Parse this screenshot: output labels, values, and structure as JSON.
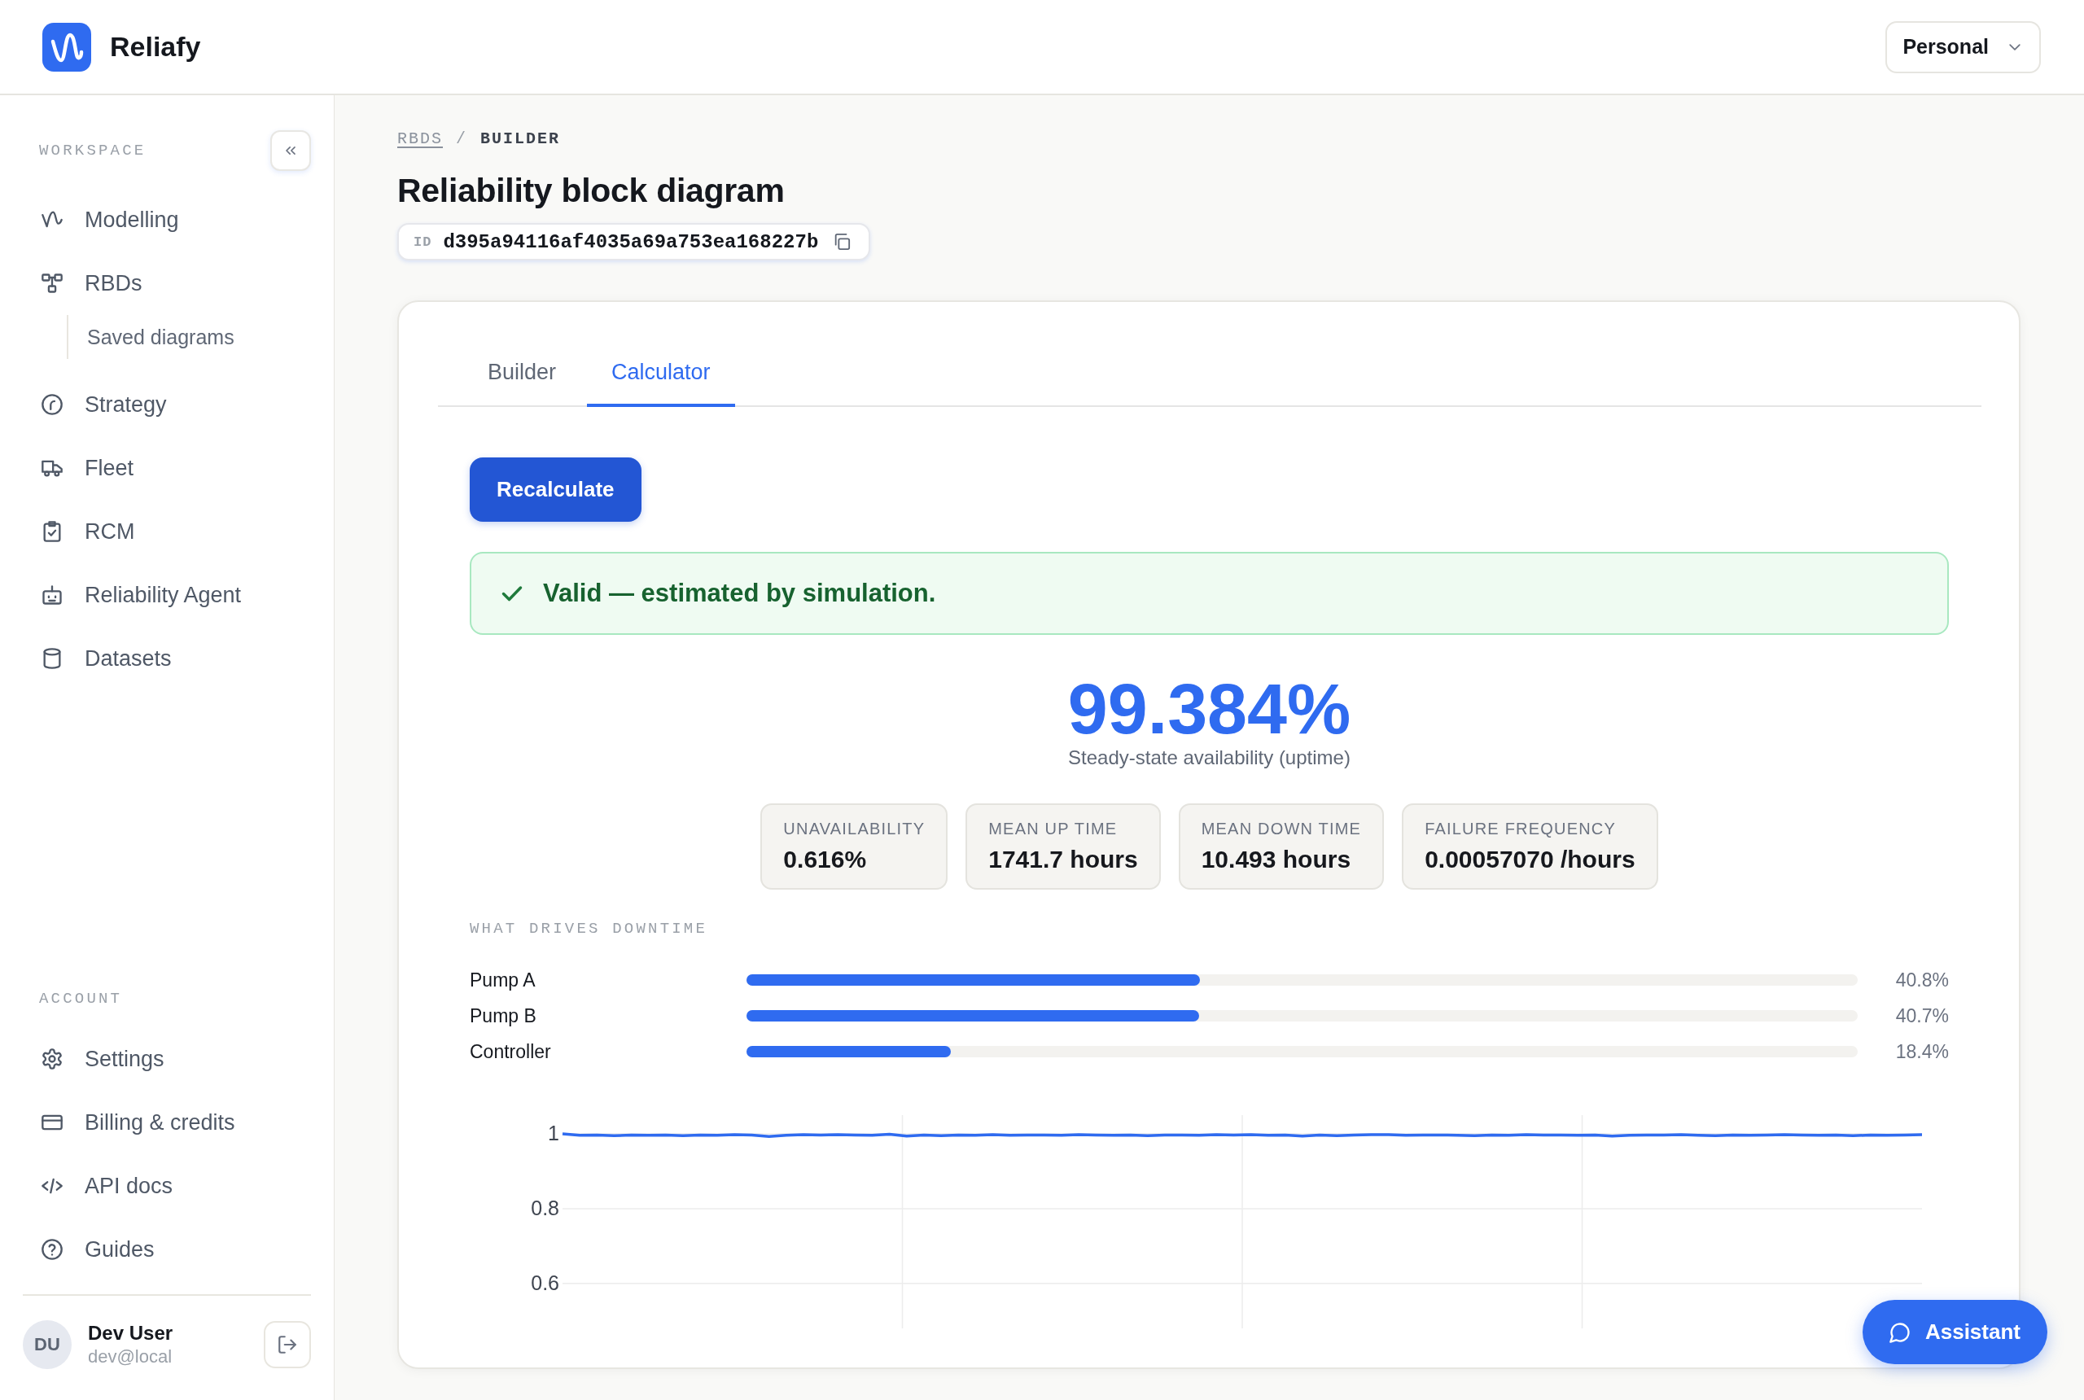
{
  "header": {
    "app_name": "Reliafy",
    "workspace_menu": {
      "label": "Personal"
    }
  },
  "sidebar": {
    "sections": [
      {
        "title": "WORKSPACE",
        "items": [
          {
            "label": "Modelling",
            "selected": false
          },
          {
            "label": "RBDs",
            "selected": false,
            "children": [
              {
                "label": "Saved diagrams",
                "selected": false
              }
            ]
          },
          {
            "label": "Strategy",
            "selected": false
          },
          {
            "label": "Fleet",
            "selected": false
          },
          {
            "label": "RCM",
            "selected": false
          },
          {
            "label": "Reliability Agent",
            "selected": false
          },
          {
            "label": "Datasets",
            "selected": false
          }
        ]
      },
      {
        "title": "ACCOUNT",
        "items": [
          {
            "label": "Settings",
            "selected": false
          },
          {
            "label": "Billing & credits",
            "selected": false
          },
          {
            "label": "API docs",
            "selected": false
          },
          {
            "label": "Guides",
            "selected": false
          }
        ]
      }
    ],
    "user": {
      "initials": "DU",
      "name": "Dev User",
      "email": "dev@local"
    }
  },
  "breadcrumb": {
    "separator": "/",
    "items": [
      {
        "kind": "link",
        "label": "RBDS"
      },
      {
        "kind": "current",
        "label": "BUILDER"
      }
    ]
  },
  "page_title": "Reliability block diagram",
  "id_chip": {
    "label": "ID",
    "value": "d395a94116af4035a69a753ea168227b"
  },
  "tabs": [
    {
      "label": "Builder",
      "selected": false
    },
    {
      "label": "Calculator",
      "selected": true
    }
  ],
  "calculator": {
    "recalculate_button": "Recalculate",
    "status": {
      "kind": "success",
      "text": "Valid — estimated by simulation."
    },
    "headline": {
      "value": "99.384%",
      "caption": "Steady-state availability (uptime)"
    },
    "metrics": [
      {
        "label": "UNAVAILABILITY",
        "value": "0.616%"
      },
      {
        "label": "MEAN UP TIME",
        "value": "1741.7 hours"
      },
      {
        "label": "MEAN DOWN TIME",
        "value": "10.493 hours"
      },
      {
        "label": "FAILURE FREQUENCY",
        "value": "0.00057070 /hours"
      }
    ],
    "downtime_drivers": {
      "title": "WHAT DRIVES DOWNTIME",
      "items": [
        {
          "name": "Pump A",
          "level": 0.408,
          "reading": "40.8%"
        },
        {
          "name": "Pump B",
          "level": 0.407,
          "reading": "40.7%"
        },
        {
          "name": "Controller",
          "level": 0.184,
          "reading": "18.4%"
        }
      ]
    },
    "chart": {
      "chart_data": {
        "type": "line",
        "grid": true,
        "ylim": [
          0.48,
          1.05
        ],
        "yticks": [
          0.6,
          0.8,
          1
        ],
        "series": [
          {
            "color": "#2f6bf0",
            "values": [
              1.0,
              0.996,
              0.997,
              0.995,
              0.997,
              0.996,
              0.997,
              0.995,
              0.997,
              0.996,
              0.998,
              0.997,
              0.993,
              0.996,
              0.998,
              0.997,
              0.998,
              0.997,
              0.996,
              0.999,
              0.994,
              0.997,
              0.995,
              0.997,
              0.996,
              0.998,
              0.996,
              0.997,
              0.997,
              0.996,
              0.998,
              0.997,
              0.996,
              0.997,
              0.995,
              0.997,
              0.997,
              0.996,
              0.998,
              0.997,
              0.998,
              0.996,
              0.997,
              0.994,
              0.997,
              0.995,
              0.997,
              0.998,
              0.998,
              0.996,
              0.997,
              0.997,
              0.996,
              0.995,
              0.997,
              0.996,
              0.998,
              0.997,
              0.997,
              0.996,
              0.997,
              0.994,
              0.996,
              0.997,
              0.997,
              0.998,
              0.996,
              0.995,
              0.997,
              0.996,
              0.997,
              0.998,
              0.997,
              0.996,
              0.997,
              0.995,
              0.997,
              0.996,
              0.997,
              0.998
            ]
          }
        ]
      }
    }
  },
  "assistant_button": {
    "label": "Assistant"
  }
}
